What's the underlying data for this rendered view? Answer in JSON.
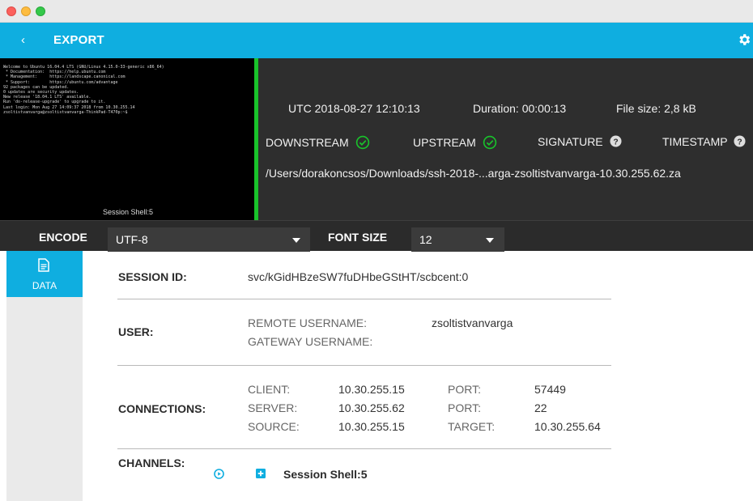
{
  "header": {
    "back_glyph": "‹",
    "title": "EXPORT",
    "icons": [
      "back-icon",
      "gear-icon"
    ]
  },
  "colors": {
    "accent": "#0faee0",
    "dark": "#2e2e2e",
    "signature_bar": "#19c32b",
    "check": "#19c32b"
  },
  "terminal": {
    "lines": [
      "Welcome to Ubuntu 16.04.4 LTS (GNU/Linux 4.15.0-33-generic x86_64)",
      "",
      " * Documentation:  https://help.ubuntu.com",
      " * Management:     https://landscape.canonical.com",
      " * Support:        https://ubuntu.com/advantage",
      "",
      "92 packages can be updated.",
      "0 updates are security updates.",
      "",
      "New release '18.04.1 LTS' available.",
      "Run 'do-release-upgrade' to upgrade to it.",
      "",
      "Last login: Mon Aug 27 14:09:37 2018 from 10.30.255.14",
      "zsoltistvanvarga@zsoltistvanvarga-ThinkPad-T470p:~$ "
    ],
    "caption": "Session Shell:5"
  },
  "meta": {
    "utc": "UTC 2018-08-27 12:10:13",
    "duration": "Duration: 00:00:13",
    "file_size": "File size: 2,8 kB",
    "downstream": "DOWNSTREAM",
    "upstream": "UPSTREAM",
    "signature": "SIGNATURE",
    "timestamp": "TIMESTAMP",
    "path": "/Users/dorakoncsos/Downloads/ssh-2018-...arga-zsoltistvanvarga-10.30.255.62.za"
  },
  "toolbar": {
    "encode_label": "ENCODE",
    "encode_value": "UTF-8",
    "font_size_label": "FONT SIZE",
    "font_size_value": "12"
  },
  "nav": {
    "data_label": "DATA"
  },
  "details": {
    "session_id_label": "SESSION ID:",
    "session_id": "svc/kGidHBzeSW7fuDHbeGStHT/scbcent:0",
    "user_label": "USER:",
    "remote_username_label": "REMOTE USERNAME:",
    "remote_username": "zsoltistvanvarga",
    "gateway_username_label": "GATEWAY USERNAME:",
    "connections_label": "CONNECTIONS:",
    "client_label": "CLIENT:",
    "client": "10.30.255.15",
    "server_label": "SERVER:",
    "server": "10.30.255.62",
    "source_label": "SOURCE:",
    "source": "10.30.255.15",
    "port1_label": "PORT:",
    "port1": "57449",
    "port2_label": "PORT:",
    "port2": "22",
    "target_label": "TARGET:",
    "target": "10.30.255.64",
    "channels_label": "CHANNELS:",
    "channel_name": "Session Shell:5"
  }
}
